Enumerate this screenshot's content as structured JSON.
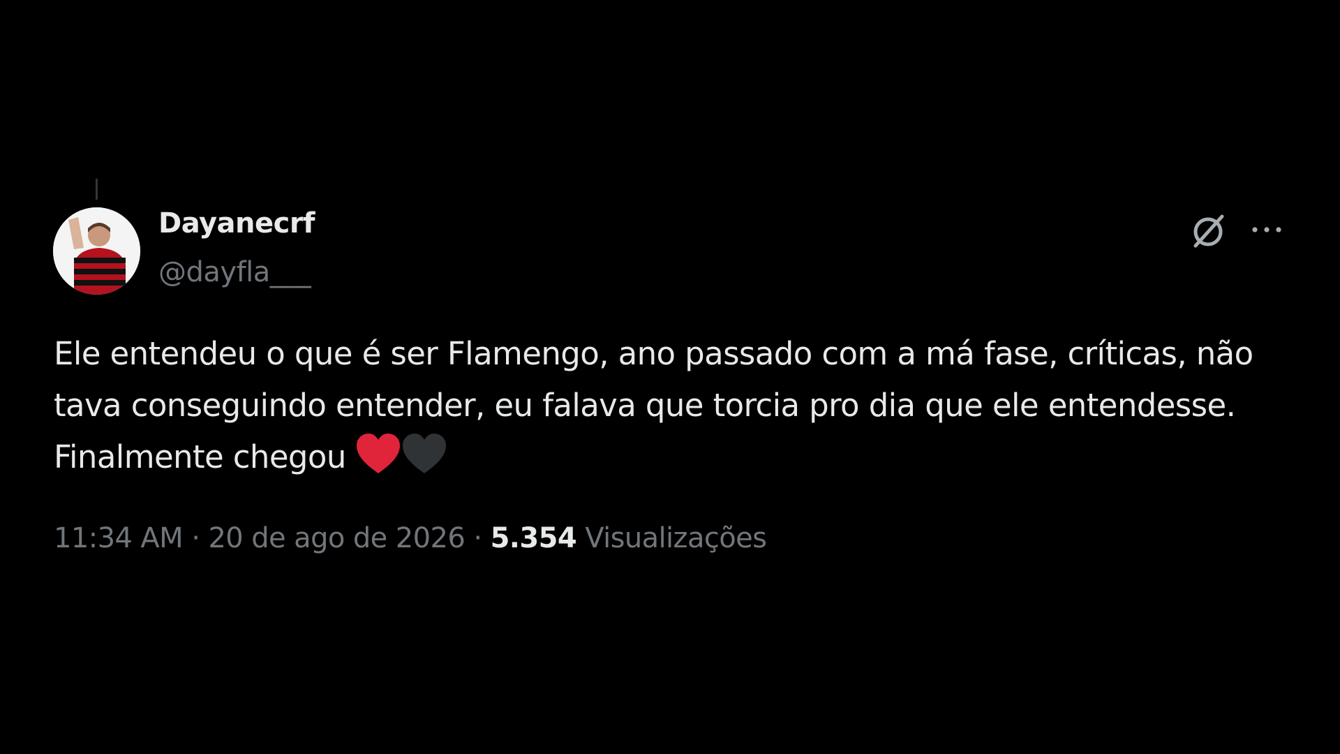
{
  "author": {
    "display_name": "Dayanecrf",
    "handle": "@dayfla___"
  },
  "tweet": {
    "text": "Ele entendeu o que é ser Flamengo, ano passado com a má fase, críticas, não tava conseguindo entender, eu falava que torcia pro dia que ele entendesse. Finalmente chegou",
    "emojis": [
      "red-heart",
      "black-heart"
    ],
    "time": "11:34 AM",
    "separator": "·",
    "date": "20 de ago de 2026",
    "views_count": "5.354",
    "views_label": "Visualizações"
  },
  "icons": {
    "grok": "grok-icon",
    "more": "more-icon"
  },
  "colors": {
    "background": "#000000",
    "primary_text": "#e7e9ea",
    "secondary_text": "#71767b",
    "red_heart": "#e0243a",
    "black_heart": "#2f3336"
  }
}
